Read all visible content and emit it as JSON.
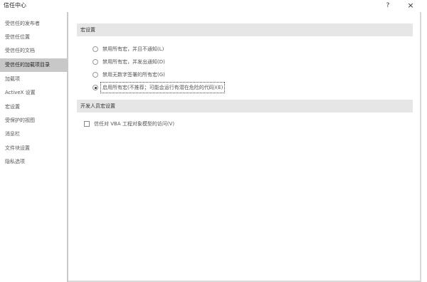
{
  "window": {
    "title": "信任中心",
    "help_label": "?",
    "close_label": "×"
  },
  "sidebar": {
    "items": [
      {
        "label": "受信任的发布者"
      },
      {
        "label": "受信任位置"
      },
      {
        "label": "受信任的文档"
      },
      {
        "label": "受信任的加载项目录",
        "active": true
      },
      {
        "label": "加载项"
      },
      {
        "label": "ActiveX 设置"
      },
      {
        "label": "宏设置"
      },
      {
        "label": "受保护的视图"
      },
      {
        "label": "消息栏"
      },
      {
        "label": "文件块设置"
      },
      {
        "label": "隐私选项"
      }
    ]
  },
  "macro_settings": {
    "header": "宏设置",
    "options": [
      {
        "label": "禁用所有宏，并且不通知(L)",
        "checked": false
      },
      {
        "label": "禁用所有宏，并发出通知(D)",
        "checked": false
      },
      {
        "label": "禁用无数字签署的所有宏(G)",
        "checked": false
      },
      {
        "label": "启用所有宏(不推荐；可能会运行有潜在危险的代码)(E)",
        "checked": true
      }
    ]
  },
  "developer_settings": {
    "header": "开发人员宏设置",
    "trust_vba_label": "信任对 VBA 工程对象模型的访问(V)",
    "trust_vba_checked": false
  }
}
